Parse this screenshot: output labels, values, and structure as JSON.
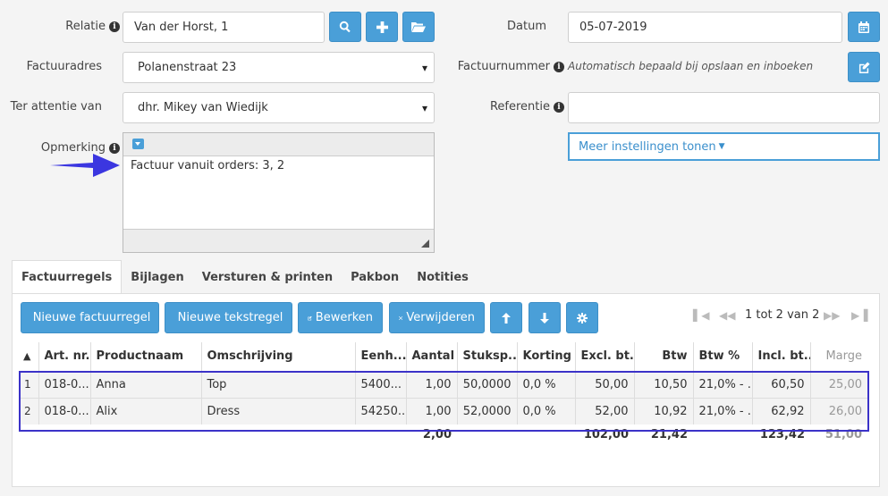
{
  "form": {
    "relatie_label": "Relatie",
    "relatie_value": "Van der Horst, 1",
    "factuuradres_label": "Factuuradres",
    "factuuradres_value": "Polanenstraat 23",
    "attentie_label": "Ter attentie van",
    "attentie_value": "dhr. Mikey van Wiedijk",
    "opmerking_label": "Opmerking",
    "opmerking_value": "Factuur vanuit orders: 3, 2",
    "datum_label": "Datum",
    "datum_value": "05-07-2019",
    "factuurnummer_label": "Factuurnummer",
    "factuurnummer_hint": "Automatisch bepaald bij opslaan en inboeken",
    "referentie_label": "Referentie",
    "referentie_value": "",
    "meer_label": "Meer instellingen tonen",
    "info_glyph": "i"
  },
  "tabs": [
    "Factuurregels",
    "Bijlagen",
    "Versturen & printen",
    "Pakbon",
    "Notities"
  ],
  "toolbar": {
    "nieuwe_factuurregel": "Nieuwe factuurregel",
    "nieuwe_tekstregel": "Nieuwe tekstregel",
    "bewerken": "Bewerken",
    "verwijderen": "Verwijderen"
  },
  "pager": {
    "text": "1 tot 2 van 2"
  },
  "table": {
    "columns": [
      "▲",
      "Art. nr.",
      "Productnaam",
      "Omschrijving",
      "Eenh...",
      "Aantal",
      "Stuksp...",
      "Korting",
      "Excl. bt...",
      "Btw",
      "Btw %",
      "Incl. bt...",
      "Marge"
    ],
    "rows": [
      [
        "1",
        "018-0...",
        "Anna",
        "Top",
        "5400...",
        "1,00",
        "50,0000",
        "0,0 %",
        "50,00",
        "10,50",
        "21,0% - ...",
        "60,50",
        "25,00"
      ],
      [
        "2",
        "018-0...",
        "Alix",
        "Dress",
        "54250...",
        "1,00",
        "52,0000",
        "0,0 %",
        "52,00",
        "10,92",
        "21,0% - ...",
        "62,92",
        "26,00"
      ]
    ],
    "totals": [
      "",
      "",
      "",
      "",
      "",
      "2,00",
      "",
      "",
      "102,00",
      "21,42",
      "",
      "123,42",
      "51,00"
    ]
  }
}
